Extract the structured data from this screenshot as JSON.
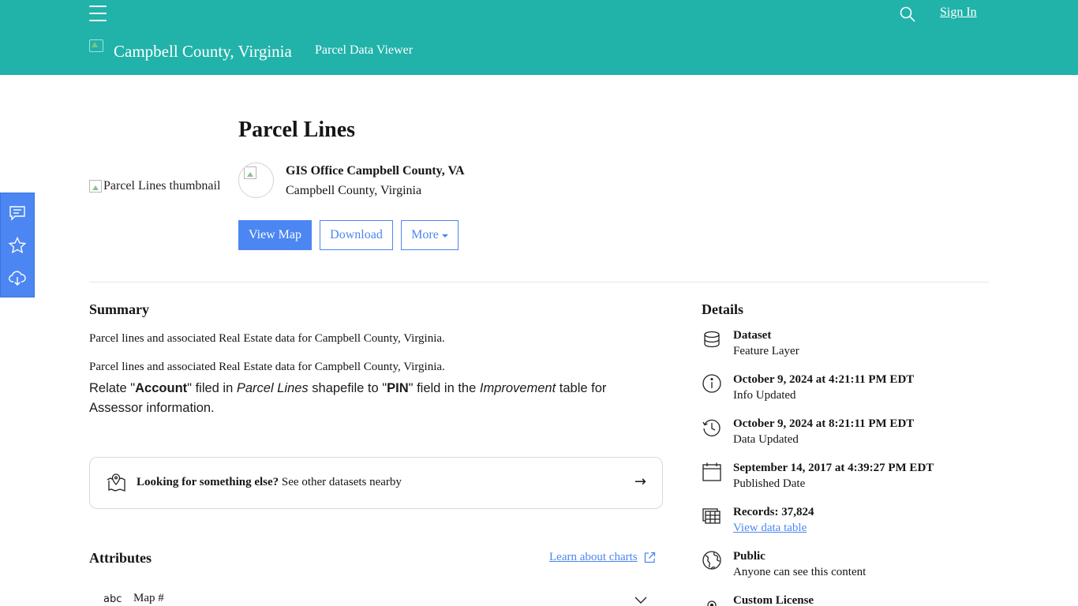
{
  "header": {
    "menu_icon": "hamburger-menu-icon",
    "search_icon": "search-icon",
    "sign_in": "Sign In",
    "site_title": "Campbell County, Virginia",
    "site_subtitle": "Parcel Data Viewer",
    "bg_color": "#21b2a9"
  },
  "side_rail": {
    "items": [
      "comment-icon",
      "star-icon",
      "cloud-download-icon"
    ],
    "bg_color": "#4c86f2"
  },
  "item": {
    "thumbnail_alt": "Parcel Lines thumbnail",
    "title": "Parcel Lines",
    "owner_name": "GIS Office Campbell County, VA",
    "owner_org": "Campbell County, Virginia",
    "actions": {
      "view_map": "View Map",
      "download": "Download",
      "more": "More"
    }
  },
  "summary": {
    "heading": "Summary",
    "snippet": "Parcel lines and associated Real Estate data for Campbell County, Virginia.",
    "description_first": "Parcel lines and associated Real Estate data for Campbell County, Virginia.",
    "description_parts": {
      "t1": "Relate \"",
      "b1": "Account",
      "t2": "\" filed in ",
      "i1": "Parcel Lines",
      "t3": " shapefile to \"",
      "b2": "PIN",
      "t4": "\" field in the ",
      "i2": "Improvement",
      "t5": " table for Assessor information."
    }
  },
  "nearby": {
    "bold": "Looking for something else?",
    "text": "See other datasets nearby",
    "arrow": "→"
  },
  "attributes": {
    "heading": "Attributes",
    "learn_link": "Learn about charts",
    "rows": [
      {
        "type": "abc",
        "name": "Map #"
      }
    ]
  },
  "details": {
    "heading": "Details",
    "items": [
      {
        "icon": "database-icon",
        "main": "Dataset",
        "sub": "Feature Layer"
      },
      {
        "icon": "info-icon",
        "main": "October 9, 2024 at 4:21:11 PM EDT",
        "sub": "Info Updated"
      },
      {
        "icon": "history-icon",
        "main": "October 9, 2024 at 8:21:11 PM EDT",
        "sub": "Data Updated"
      },
      {
        "icon": "calendar-icon",
        "main": "September 14, 2017 at 4:39:27 PM EDT",
        "sub": "Published Date"
      },
      {
        "icon": "table-icon",
        "main": "Records: 37,824",
        "sub": "View data table"
      },
      {
        "icon": "globe-icon",
        "main": "Public",
        "sub": "Anyone can see this content"
      },
      {
        "icon": "license-icon",
        "main": "Custom License",
        "sub": ""
      }
    ]
  }
}
